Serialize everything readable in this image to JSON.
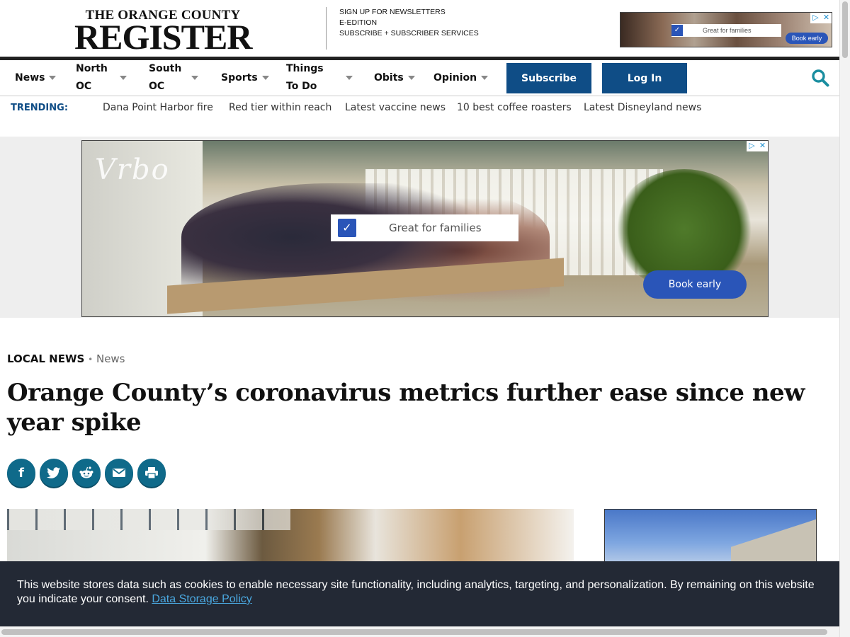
{
  "header": {
    "logo_line1": "THE ORANGE COUNTY",
    "logo_line2": "REGISTER",
    "links": [
      "SIGN UP FOR NEWSLETTERS",
      "E-EDITION",
      "SUBSCRIBE + SUBSCRIBER SERVICES"
    ]
  },
  "top_ad": {
    "checkbox_label": "Great for families",
    "button_label": "Book early"
  },
  "nav": {
    "items": [
      {
        "label": "News"
      },
      {
        "label": "North OC"
      },
      {
        "label": "South OC"
      },
      {
        "label": "Sports"
      },
      {
        "label": "Things To Do"
      },
      {
        "label": "Obits"
      },
      {
        "label": "Opinion"
      }
    ],
    "subscribe_label": "Subscribe",
    "login_label": "Log In",
    "accent_color": "#0f4d86"
  },
  "trending": {
    "label": "TRENDING:",
    "links": [
      "Dana Point Harbor fire",
      "Red tier within reach",
      "Latest vaccine news",
      "10 best coffee roasters",
      "Latest Disneyland news"
    ]
  },
  "big_ad": {
    "logo_text": "Vrbo",
    "checkbox_label": "Great for families",
    "button_label": "Book early"
  },
  "article": {
    "section": "LOCAL NEWS",
    "separator": "•",
    "subsection": "News",
    "headline": "Orange County’s coronavirus metrics further ease since new year spike",
    "share_buttons": [
      {
        "name": "facebook-icon",
        "glyph": "f"
      },
      {
        "name": "twitter-icon",
        "glyph": "🐦"
      },
      {
        "name": "reddit-icon",
        "glyph": "👽"
      },
      {
        "name": "email-icon",
        "glyph": "✉"
      },
      {
        "name": "print-icon",
        "glyph": "⎙"
      }
    ],
    "share_color": "#0f6a8a"
  },
  "cookie_banner": {
    "text": "This website stores data such as cookies to enable necessary site functionality, including analytics, targeting, and personalization. By remaining on this website you indicate your consent.",
    "link_text": "Data Storage Policy"
  }
}
